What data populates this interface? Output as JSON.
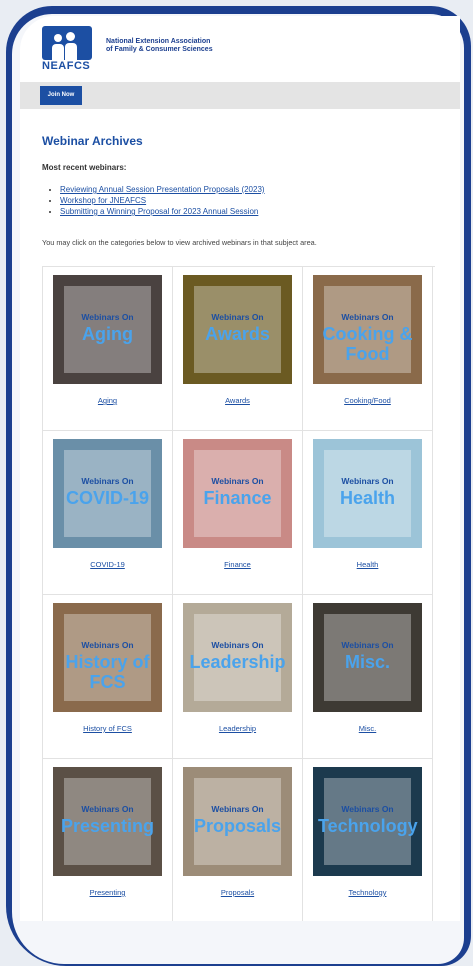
{
  "org": {
    "logo_text": "NEAFCS",
    "name_line1": "National Extension Association",
    "name_line2": "of Family & Consumer Sciences"
  },
  "nav": {
    "join_label": "Join Now"
  },
  "page": {
    "title": "Webinar Archives",
    "recent_label": "Most recent webinars:",
    "recent_links": [
      "Reviewing Annual Session Presentation Proposals (2023)",
      "Workshop for JNEAFCS",
      "Submitting a Winning Proposal for 2023 Annual Session"
    ],
    "intro": "You may click on the categories below to view archived webinars in that subject area."
  },
  "categories": [
    {
      "overlay_small": "Webinars On",
      "overlay_big": "Aging",
      "caption": "Aging",
      "bg": "#4a4240"
    },
    {
      "overlay_small": "Webinars On",
      "overlay_big": "Awards",
      "caption": "Awards",
      "bg": "#6b5a22"
    },
    {
      "overlay_small": "Webinars On",
      "overlay_big": "Cooking & Food",
      "caption": "Cooking/Food",
      "bg": "#8a6a4a"
    },
    {
      "overlay_small": "Webinars On",
      "overlay_big": "COVID-19",
      "caption": "COVID-19",
      "bg": "#6a8fa8"
    },
    {
      "overlay_small": "Webinars On",
      "overlay_big": "Finance",
      "caption": "Finance",
      "bg": "#c98a86"
    },
    {
      "overlay_small": "Webinars On",
      "overlay_big": "Health",
      "caption": "Health",
      "bg": "#9cc4d8"
    },
    {
      "overlay_small": "Webinars On",
      "overlay_big": "History of FCS",
      "caption": "History of FCS",
      "bg": "#8a6a4c"
    },
    {
      "overlay_small": "Webinars On",
      "overlay_big": "Leadership",
      "caption": "Leadership",
      "bg": "#b4aa98"
    },
    {
      "overlay_small": "Webinars On",
      "overlay_big": "Misc.",
      "caption": "Misc.",
      "bg": "#3e3a34"
    },
    {
      "overlay_small": "Webinars On",
      "overlay_big": "Presenting",
      "caption": "Presenting",
      "bg": "#5b5046"
    },
    {
      "overlay_small": "Webinars On",
      "overlay_big": "Proposals",
      "caption": "Proposals",
      "bg": "#9c8c78"
    },
    {
      "overlay_small": "Webinars On",
      "overlay_big": "Technology",
      "caption": "Technology",
      "bg": "#1c3a4e"
    }
  ],
  "colors": {
    "brand": "#1c4fa3",
    "frame": "#1c3f8f",
    "link": "#1c4fa3"
  }
}
